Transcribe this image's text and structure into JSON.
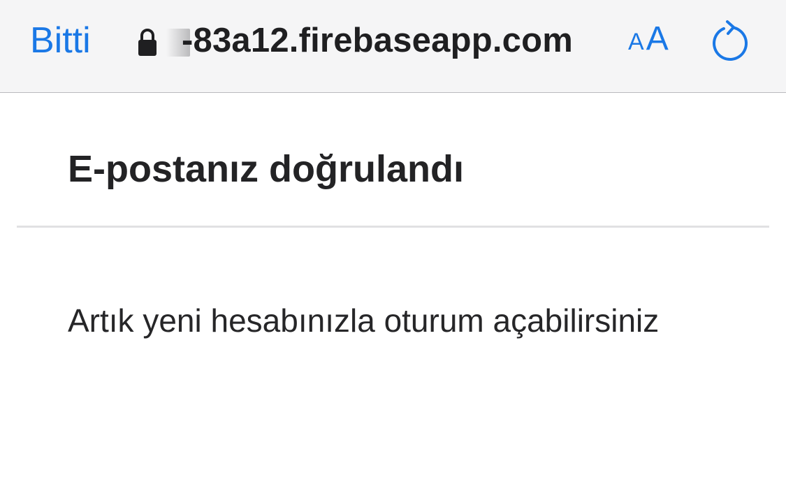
{
  "browser": {
    "done_label": "Bitti",
    "url_domain": "-83a12.firebaseapp.com",
    "text_size_small": "A",
    "text_size_large": "A",
    "accent_color": "#1a78e6"
  },
  "page": {
    "title": "E-postanız doğrulandı",
    "message": "Artık yeni hesabınızla oturum açabilirsiniz"
  },
  "icons": {
    "lock": "lock-icon",
    "reload": "reload-icon"
  }
}
